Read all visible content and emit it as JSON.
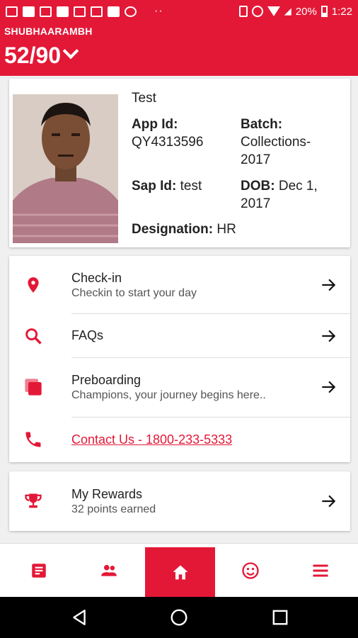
{
  "status_bar": {
    "battery": "20%",
    "time": "1:22"
  },
  "header": {
    "title": "SHUBHAARAMBH",
    "progress": "52/90"
  },
  "profile": {
    "name": "Test",
    "app_id_label": "App Id:",
    "app_id": "QY4313596",
    "batch_label": "Batch:",
    "batch_line1": "Collections-",
    "batch_line2": "2017",
    "sap_id_label": "Sap Id:",
    "sap_id": "test",
    "dob_label": "DOB:",
    "dob_line1": "Dec 1,",
    "dob_line2": "2017",
    "designation_label": "Designation:",
    "designation": "HR"
  },
  "menu": {
    "checkin": {
      "label": "Check-in",
      "sub": "Checkin to start your day"
    },
    "faqs": {
      "label": "FAQs"
    },
    "preboarding": {
      "label": "Preboarding",
      "sub": "Champions, your journey begins here.."
    },
    "contact": {
      "label": "Contact Us - 1800-233-5333"
    }
  },
  "rewards": {
    "label": "My Rewards",
    "sub": "32 points earned"
  },
  "colors": {
    "accent": "#e31837"
  },
  "icons": [
    "location-pin-icon",
    "search-icon",
    "stack-icon",
    "phone-icon",
    "trophy-icon",
    "arrow-right-icon",
    "document-icon",
    "people-icon",
    "home-icon",
    "smiley-icon",
    "menu-icon"
  ]
}
